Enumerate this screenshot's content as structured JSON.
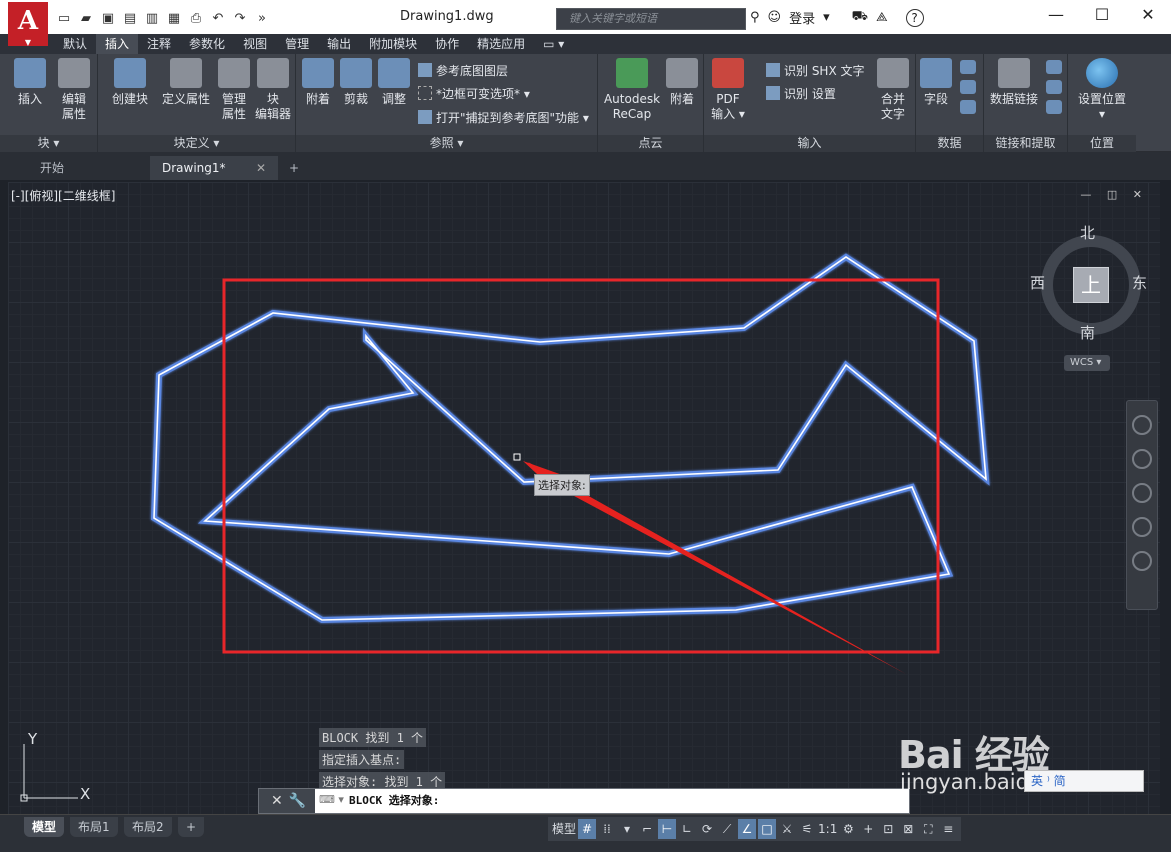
{
  "titlebar": {
    "logo_letter": "A",
    "document_title": "Drawing1.dwg",
    "search_placeholder": "键入关键字或短语",
    "login_label": "登录",
    "help_label": "?"
  },
  "ribbon_tabs": [
    "默认",
    "插入",
    "注释",
    "参数化",
    "视图",
    "管理",
    "输出",
    "附加模块",
    "协作",
    "精选应用"
  ],
  "ribbon_active_tab": "插入",
  "panels": {
    "block": {
      "title": "块",
      "insert": "插入",
      "edit_attr_1": "编辑",
      "edit_attr_2": "属性"
    },
    "block_def": {
      "title": "块定义",
      "create": "创建块",
      "define_attr": "定义属性",
      "manage_attr_1": "管理",
      "manage_attr_2": "属性",
      "block_editor_1": "块",
      "block_editor_2": "编辑器"
    },
    "reference": {
      "title": "参照",
      "attach": "附着",
      "clip": "剪裁",
      "adjust": "调整",
      "underlay_layers": "参考底图图层",
      "frame_option": "*边框可变选项*",
      "snap_underlay": "打开\"捕捉到参考底图\"功能"
    },
    "pointcloud": {
      "title": "点云",
      "recap_1": "Autodesk",
      "recap_2": "ReCap",
      "attach": "附着"
    },
    "import": {
      "title": "输入",
      "pdf_1": "PDF",
      "pdf_2": "输入",
      "shx": "识别 SHX 文字",
      "recognize_settings": "识别 设置",
      "combine_1": "合并",
      "combine_2": "文字"
    },
    "data": {
      "title": "数据",
      "field": "字段"
    },
    "linking": {
      "title": "链接和提取",
      "data_link": "数据链接"
    },
    "location": {
      "title": "位置",
      "set_location": "设置位置"
    }
  },
  "doc_tabs": {
    "start": "开始",
    "drawing": "Drawing1*",
    "add": "+"
  },
  "viewport": {
    "label": "[-][俯视][二维线框]",
    "viewcube": {
      "north": "北",
      "south": "南",
      "east": "东",
      "west": "西",
      "top": "上",
      "wcs": "WCS"
    },
    "tooltip": "选择对象:",
    "ucs_x": "X",
    "ucs_y": "Y"
  },
  "command_history": [
    "BLOCK 找到 1 个",
    "指定插入基点:",
    "选择对象: 找到 1 个"
  ],
  "command_line": {
    "prompt": "BLOCK 选择对象:"
  },
  "status": {
    "layouts": [
      "模型",
      "布局1",
      "布局2"
    ],
    "active_layout": "模型",
    "model_label": "模型",
    "scale": "1:1"
  },
  "watermark": {
    "brand": "Bai 经验",
    "url": "jingyan.baidu.com",
    "badge": "英 ⁾ 简"
  },
  "colors": {
    "highlight_rect": "#e8262a",
    "polyline": "#9ec3ff",
    "arrow": "#e5221f"
  }
}
